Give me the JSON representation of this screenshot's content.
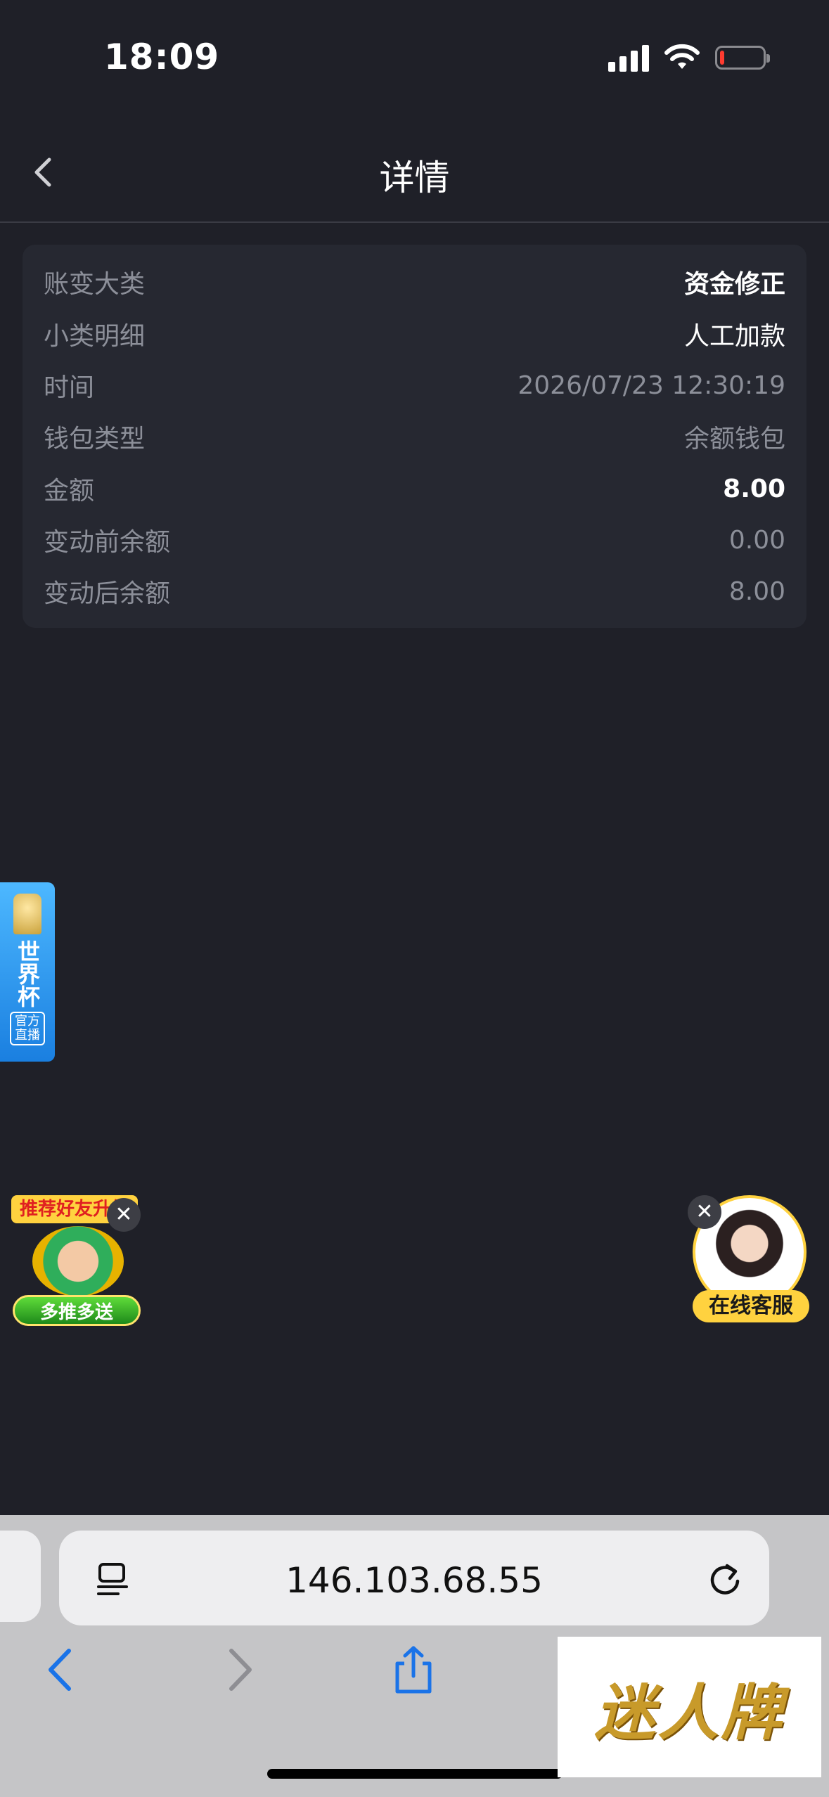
{
  "status_bar": {
    "time": "18:09"
  },
  "header": {
    "title": "详情"
  },
  "details": [
    {
      "label": "账变大类",
      "value": "资金修正"
    },
    {
      "label": "小类明细",
      "value": "人工加款"
    },
    {
      "label": "时间",
      "value": "2026/07/23 12:30:19"
    },
    {
      "label": "钱包类型",
      "value": "余额钱包"
    },
    {
      "label": "金额",
      "value": "8.00"
    },
    {
      "label": "变动前余额",
      "value": "0.00"
    },
    {
      "label": "变动后余额",
      "value": "8.00"
    }
  ],
  "world_cup": {
    "title": "世界杯",
    "sub": "官方直播"
  },
  "referral": {
    "title": "推荐好友升级",
    "button": "多推多送"
  },
  "service": {
    "label": "在线客服"
  },
  "browser": {
    "url": "146.103.68.55"
  },
  "watermark": {
    "text": "迷人牌"
  },
  "colors": {
    "background": "#1f2028",
    "card": "#262831",
    "accent_yellow": "#ffd23f",
    "browser_blue": "#1a73e8"
  }
}
